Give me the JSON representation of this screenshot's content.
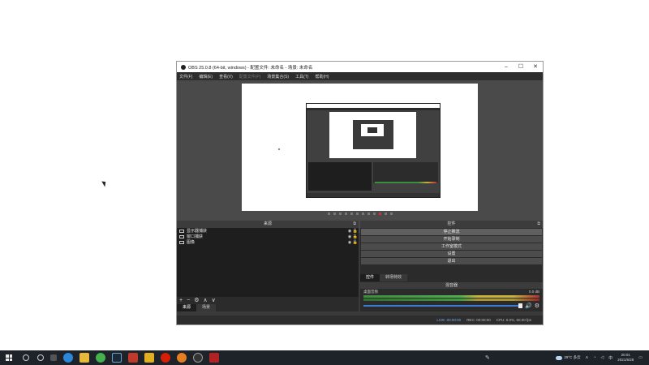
{
  "window": {
    "title": "OBS 25.0.8 (64-bit, windows) - 配置文件: 未命名 - 场景: 未命名",
    "minimize": "–",
    "maximize": "☐",
    "close": "✕"
  },
  "menu": [
    {
      "label": "文件(F)",
      "enabled": true
    },
    {
      "label": "编辑(E)",
      "enabled": true
    },
    {
      "label": "查看(V)",
      "enabled": true
    },
    {
      "label": "配置文件(P)",
      "enabled": false
    },
    {
      "label": "场景集合(S)",
      "enabled": true
    },
    {
      "label": "工具(T)",
      "enabled": true
    },
    {
      "label": "帮助(H)",
      "enabled": true
    }
  ],
  "sources": {
    "header": "来源",
    "items": [
      {
        "label": "显示器捕获"
      },
      {
        "label": "窗口捕获"
      },
      {
        "label": "图像"
      }
    ],
    "toolbar": {
      "add": "+",
      "remove": "−",
      "settings": "⚙",
      "up": "∧",
      "down": "∨"
    },
    "tabs": [
      "来源",
      "场景"
    ]
  },
  "controls": {
    "header": "控件",
    "buttons": [
      "停止推流",
      "开始录制",
      "工作室模式",
      "设置",
      "退出"
    ],
    "tabs": [
      "控件",
      "转场特效"
    ]
  },
  "mixer": {
    "header": "混音器",
    "track_name": "桌面音频",
    "track_db": "0.0 dB"
  },
  "status": {
    "live": "LIVE: 00:00:00",
    "rec": "REC: 00:00:00",
    "cpu": "CPU: 0.0%, 60.00 fps"
  },
  "taskbar": {
    "weather": "29°C 多云",
    "time": "20:01",
    "date": "2021/6/28"
  }
}
